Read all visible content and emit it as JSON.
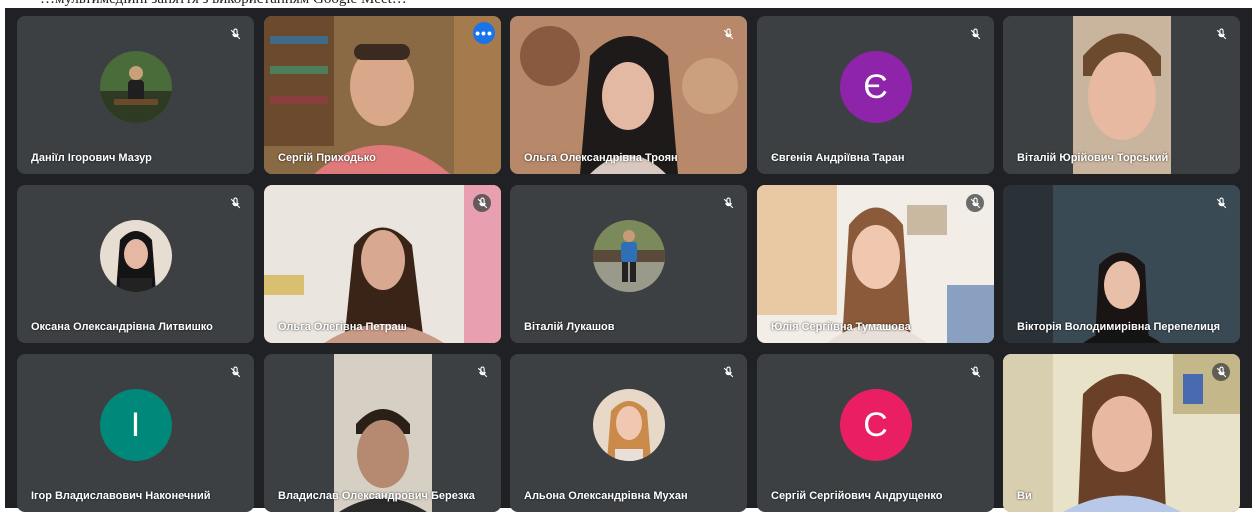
{
  "caption_top_text": "…мультимедійні заняття з використанням Google Meet…",
  "participants": [
    {
      "name": "Даніїл Ігорович Мазур",
      "muted": true
    },
    {
      "name": "Сергій Приходько",
      "muted": false,
      "options_label": "•••"
    },
    {
      "name": "Ольга Олександрівна Троян",
      "muted": true
    },
    {
      "name": "Євгенія Андріївна Таран",
      "muted": true,
      "initial": "Є",
      "avatar_color": "#8e24aa"
    },
    {
      "name": "Віталій Юрійович Торський",
      "muted": true
    },
    {
      "name": "Оксана Олександрівна Литвишко",
      "muted": true
    },
    {
      "name": "Ольга Олегівна Петраш",
      "muted": true
    },
    {
      "name": "Віталій Лукашов",
      "muted": true
    },
    {
      "name": "Юлія Сергіївна Тумашова",
      "muted": true
    },
    {
      "name": "Вікторія Володимирівна Перепелиця",
      "muted": true
    },
    {
      "name": "Ігор Владиславович Наконечний",
      "muted": true,
      "initial": "І",
      "avatar_color": "#00897b"
    },
    {
      "name": "Владислав Олександрович Березка",
      "muted": true
    },
    {
      "name": "Альона Олександрівна Мухан",
      "muted": true
    },
    {
      "name": "Сергій Сергійович Андрущенко",
      "muted": true,
      "initial": "С",
      "avatar_color": "#e91e63"
    },
    {
      "name": "Ви",
      "muted": true
    }
  ],
  "colors": {
    "grid_background": "#202124",
    "tile_background": "#3c4043",
    "active_border": "#8ab4f8",
    "options_button": "#1a73e8"
  },
  "icons": {
    "mute": "mic-off-icon",
    "options": "more-options-icon"
  }
}
